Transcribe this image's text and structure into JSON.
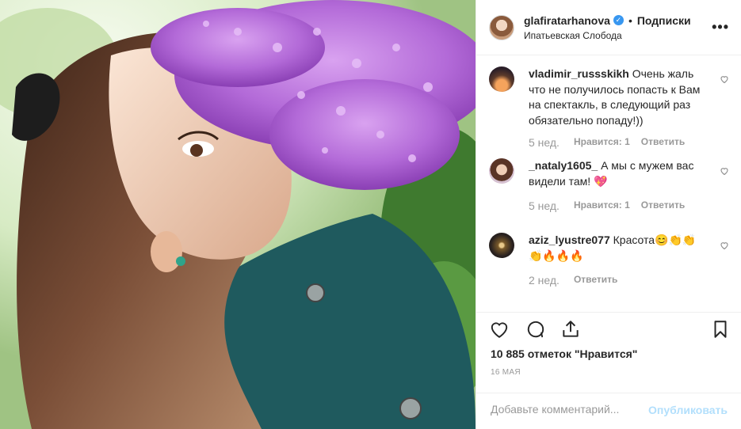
{
  "post": {
    "photo": {
      "alt": "",
      "colors": {
        "lilac": "#b36ad8",
        "leaf": "#4f8a3a",
        "hair": "#6b4330",
        "coat": "#1f5a5e"
      }
    },
    "header": {
      "username": "glafiratarhanova",
      "verified": true,
      "separator": "•",
      "follow_label": "Подписки",
      "location": "Ипатьевская Слобода",
      "more_icon": "more-icon"
    },
    "comments": [
      {
        "username": "vladimir_russskikh",
        "text": "Очень жаль что не получилось попасть к Вам на спектакль, в следующий раз обязательно попаду!))",
        "time": "5 нед.",
        "likes": "Нравится: 1",
        "reply": "Ответить"
      },
      {
        "username": "_nataly1605_",
        "text": "А мы с мужем вас видели там! 💖",
        "time": "5 нед.",
        "likes": "Нравится: 1",
        "reply": "Ответить"
      },
      {
        "username": "aziz_lyustre077",
        "text": "Красота😊👏👏👏🔥🔥🔥",
        "time": "2 нед.",
        "likes": "",
        "reply": "Ответить"
      }
    ],
    "actions": {
      "like_icon": "heart-icon",
      "comment_icon": "comment-icon",
      "share_icon": "share-icon",
      "save_icon": "bookmark-icon",
      "likes_text": "10 885 отметок \"Нравится\"",
      "date": "16 МАЯ"
    },
    "add_comment": {
      "placeholder": "Добавьте комментарий...",
      "publish_label": "Опубликовать"
    },
    "colors": {
      "link_blue": "#3897f0",
      "publish_disabled": "#b2dffc",
      "muted": "#999999",
      "border": "#efefef"
    }
  }
}
